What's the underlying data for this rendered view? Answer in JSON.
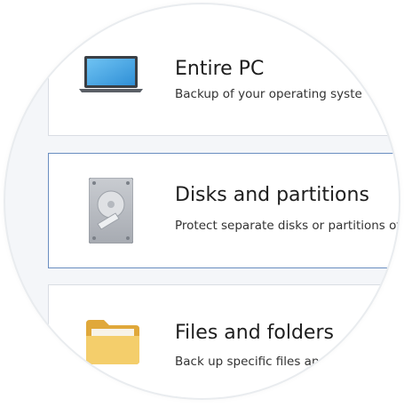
{
  "options": [
    {
      "title": "Entire PC",
      "description": "Backup of your operating syste",
      "icon": "laptop-icon"
    },
    {
      "title": "Disks and partitions",
      "description": "Protect separate disks or partitions of",
      "icon": "hard-disk-icon",
      "selected": true
    },
    {
      "title": "Files and folders",
      "description": "Back up specific files and fol",
      "icon": "folder-icon"
    }
  ],
  "colors": {
    "selected_border": "#6a8ec0",
    "card_border": "#d9dde3",
    "background": "#f4f6f9"
  }
}
